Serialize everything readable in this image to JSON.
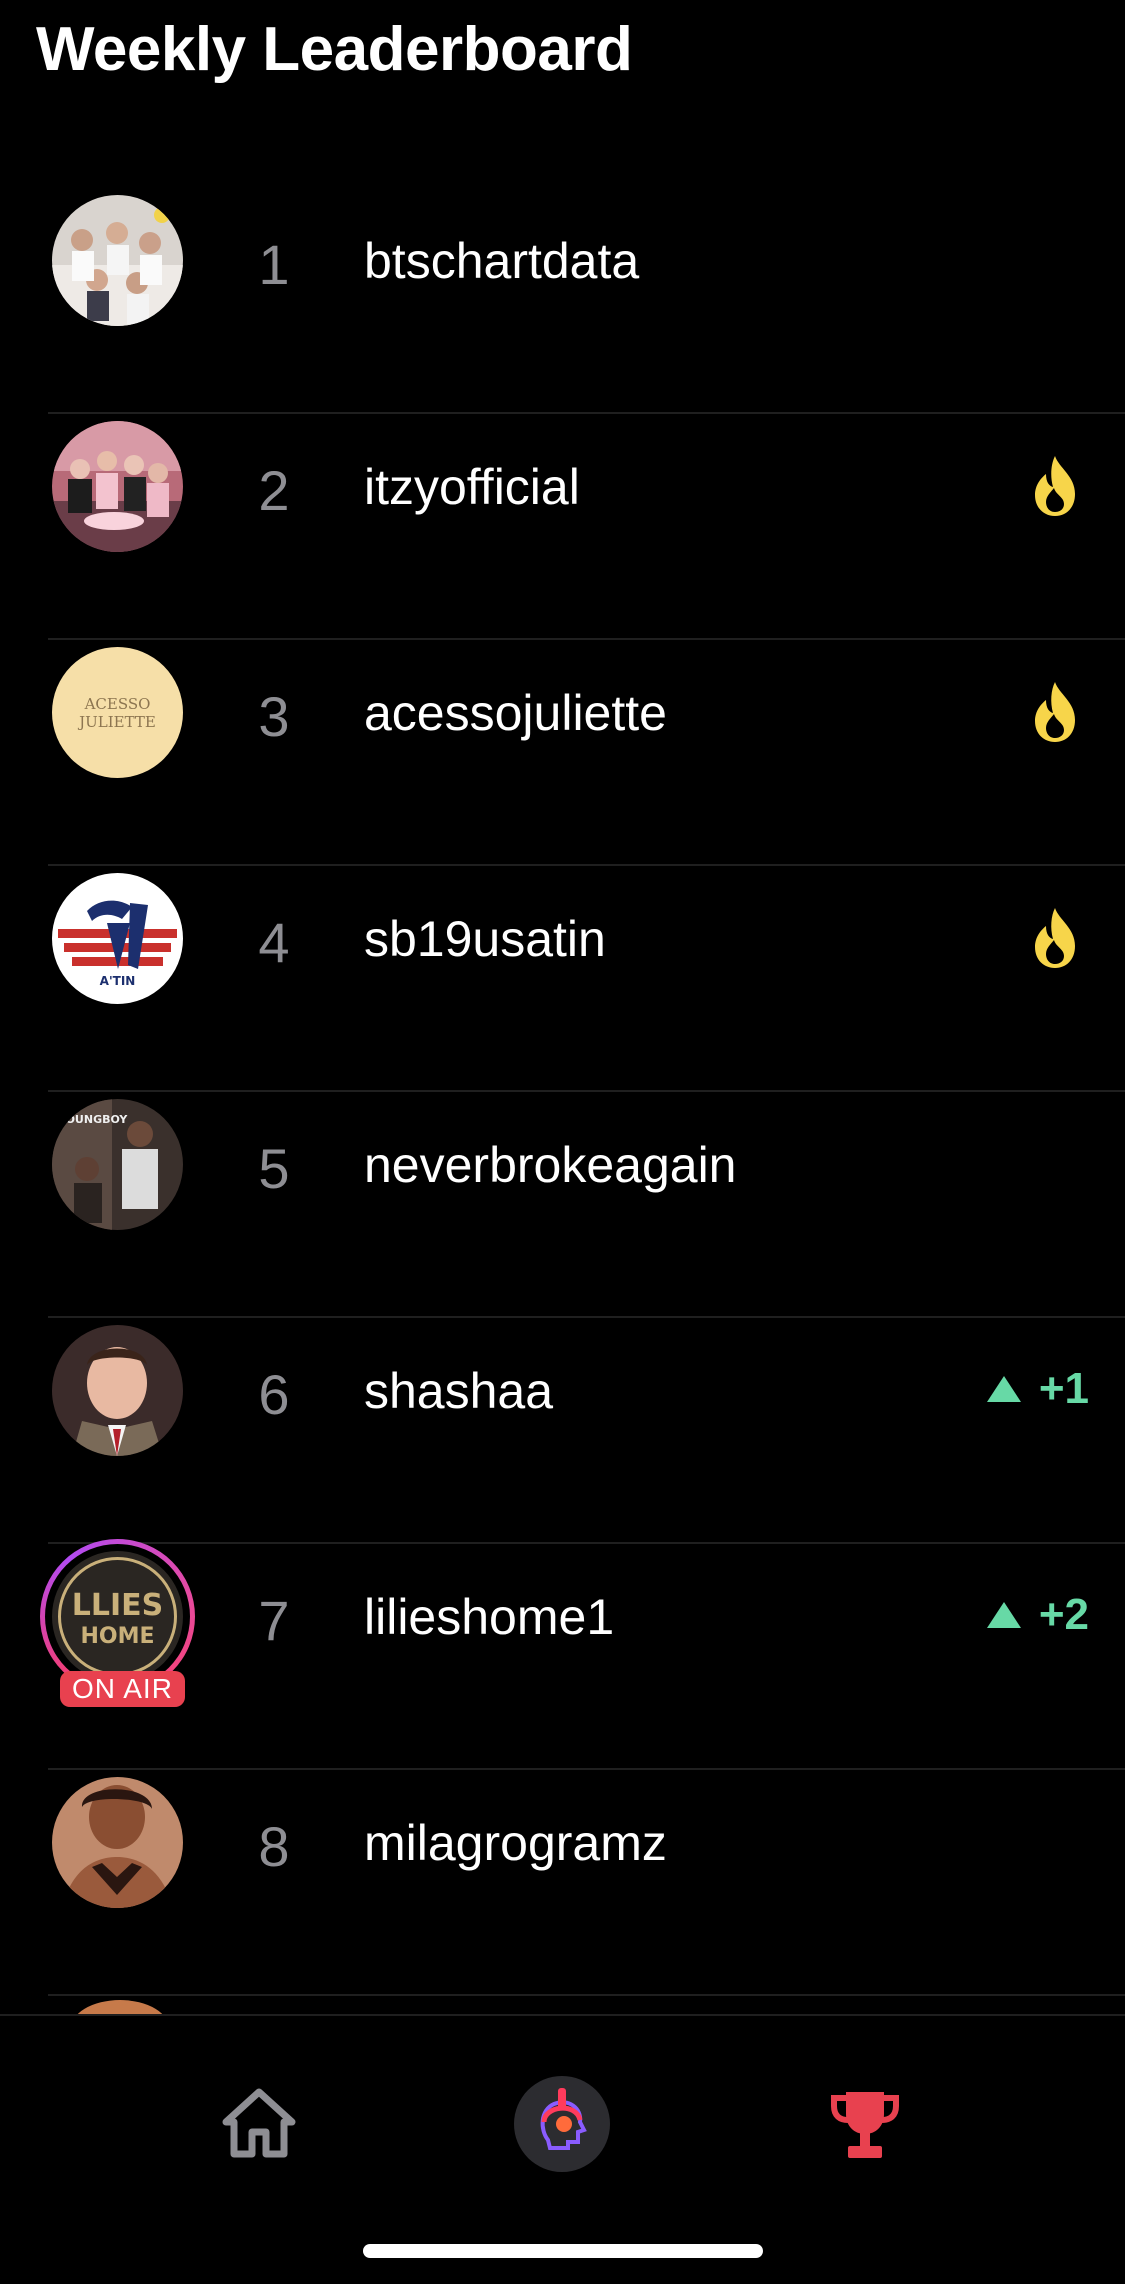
{
  "header": {
    "title": "Weekly Leaderboard"
  },
  "leaderboard": [
    {
      "rank": "1",
      "username": "btschartdata",
      "trend": "",
      "fire": false,
      "on_air": false
    },
    {
      "rank": "2",
      "username": "itzyofficial",
      "trend": "",
      "fire": true,
      "on_air": false
    },
    {
      "rank": "3",
      "username": "acessojuliette",
      "trend": "",
      "fire": true,
      "on_air": false,
      "avatar_text": [
        "ACESSO",
        "JULIETTE"
      ]
    },
    {
      "rank": "4",
      "username": "sb19usatin",
      "trend": "",
      "fire": true,
      "on_air": false,
      "avatar_text": [
        "A'TIN"
      ]
    },
    {
      "rank": "5",
      "username": "neverbrokeagain",
      "trend": "",
      "fire": false,
      "on_air": false,
      "avatar_text": [
        "YOUNGBOY"
      ]
    },
    {
      "rank": "6",
      "username": "shashaa",
      "trend": "+1",
      "fire": false,
      "on_air": false
    },
    {
      "rank": "7",
      "username": "lilieshome1",
      "trend": "+2",
      "fire": false,
      "on_air": true,
      "on_air_label": "ON AIR",
      "avatar_text": [
        "LLIES",
        "HOME"
      ]
    },
    {
      "rank": "8",
      "username": "milagrogramz",
      "trend": "",
      "fire": false,
      "on_air": false
    }
  ],
  "icons": {
    "fire": "fire-icon",
    "trend_up": "triangle-up-icon",
    "home": "home-icon",
    "center": "head-headphones-icon",
    "trophy": "trophy-icon"
  },
  "colors": {
    "background": "#000000",
    "rank": "#8e8e93",
    "trend": "#67d9a6",
    "fire": "#f7d54a",
    "active_tab": "#e8414f",
    "on_air": "#e8414f"
  }
}
